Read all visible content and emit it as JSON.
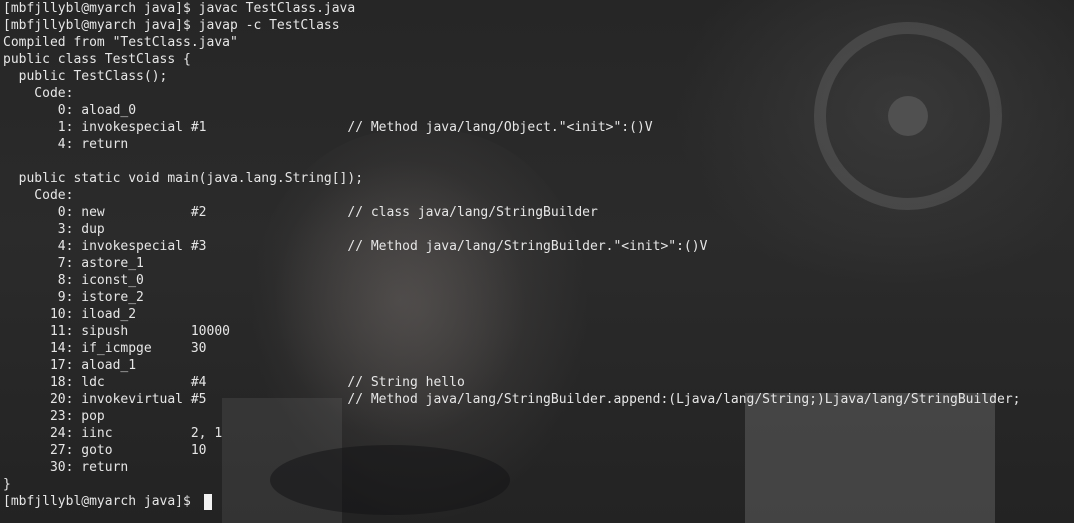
{
  "terminal": {
    "lines": [
      "[mbfjllybl@myarch java]$ javac TestClass.java",
      "[mbfjllybl@myarch java]$ javap -c TestClass",
      "Compiled from \"TestClass.java\"",
      "public class TestClass {",
      "  public TestClass();",
      "    Code:",
      "       0: aload_0",
      "       1: invokespecial #1                  // Method java/lang/Object.\"<init>\":()V",
      "       4: return",
      "",
      "  public static void main(java.lang.String[]);",
      "    Code:",
      "       0: new           #2                  // class java/lang/StringBuilder",
      "       3: dup",
      "       4: invokespecial #3                  // Method java/lang/StringBuilder.\"<init>\":()V",
      "       7: astore_1",
      "       8: iconst_0",
      "       9: istore_2",
      "      10: iload_2",
      "      11: sipush        10000",
      "      14: if_icmpge     30",
      "      17: aload_1",
      "      18: ldc           #4                  // String hello",
      "      20: invokevirtual #5                  // Method java/lang/StringBuilder.append:(Ljava/lang/String;)Ljava/lang/StringBuilder;",
      "      23: pop",
      "      24: iinc          2, 1",
      "      27: goto          10",
      "      30: return",
      "}",
      "[mbfjllybl@myarch java]$ "
    ],
    "colors": {
      "text": "#e6e6e6",
      "cursor": "#f2f2f2",
      "background": "#262626"
    }
  }
}
